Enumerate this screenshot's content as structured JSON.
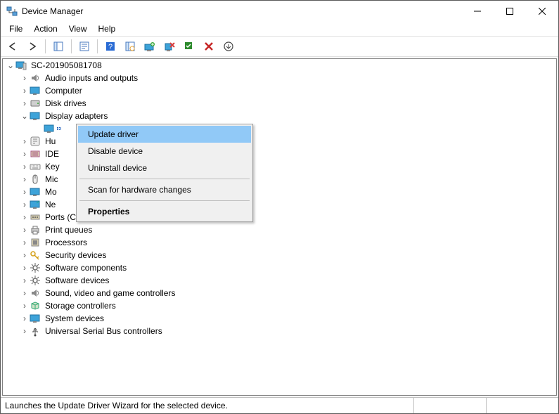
{
  "window": {
    "title": "Device Manager"
  },
  "menu": {
    "file": "File",
    "action": "Action",
    "view": "View",
    "help": "Help"
  },
  "tree": {
    "root": "SC-201905081708",
    "items": [
      {
        "label": "Audio inputs and outputs",
        "icon": "speaker"
      },
      {
        "label": "Computer",
        "icon": "monitor"
      },
      {
        "label": "Disk drives",
        "icon": "disk"
      },
      {
        "label": "Display adapters",
        "icon": "monitor",
        "expanded": true,
        "child": ""
      },
      {
        "label": "Hu",
        "icon": "hid"
      },
      {
        "label": "IDE",
        "icon": "ide"
      },
      {
        "label": "Key",
        "icon": "keyboard"
      },
      {
        "label": "Mic",
        "icon": "mouse"
      },
      {
        "label": "Mo",
        "icon": "monitor"
      },
      {
        "label": "Ne",
        "icon": "network"
      },
      {
        "label": "Ports (COM & LPT)",
        "icon": "port"
      },
      {
        "label": "Print queues",
        "icon": "printer"
      },
      {
        "label": "Processors",
        "icon": "cpu"
      },
      {
        "label": "Security devices",
        "icon": "key"
      },
      {
        "label": "Software components",
        "icon": "gear"
      },
      {
        "label": "Software devices",
        "icon": "gear"
      },
      {
        "label": "Sound, video and game controllers",
        "icon": "speaker"
      },
      {
        "label": "Storage controllers",
        "icon": "storage"
      },
      {
        "label": "System devices",
        "icon": "monitor"
      },
      {
        "label": "Universal Serial Bus controllers",
        "icon": "usb"
      }
    ]
  },
  "context_menu": {
    "update": "Update driver",
    "disable": "Disable device",
    "uninstall": "Uninstall device",
    "scan": "Scan for hardware changes",
    "properties": "Properties"
  },
  "status": "Launches the Update Driver Wizard for the selected device."
}
